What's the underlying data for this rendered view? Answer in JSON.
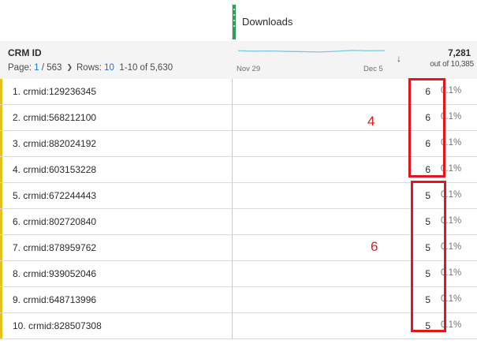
{
  "header": {
    "metric_title": "Downloads",
    "dimension_title": "CRM ID",
    "page_label": "Page:",
    "page_current": "1",
    "page_total": "/ 563",
    "rows_label": "Rows:",
    "rows_value": "10",
    "range_text": "1-10 of 5,630",
    "date_start": "Nov 29",
    "date_end": "Dec 5",
    "total_value": "7,281",
    "total_sub": "out of 10,385"
  },
  "sparkline": [
    0.62,
    0.6,
    0.61,
    0.58,
    0.57,
    0.55,
    0.59,
    0.64,
    0.62,
    0.63
  ],
  "rows": [
    {
      "label": "1. crmid:129236345",
      "value": "6",
      "pct": "0.1%"
    },
    {
      "label": "2. crmid:568212100",
      "value": "6",
      "pct": "0.1%"
    },
    {
      "label": "3. crmid:882024192",
      "value": "6",
      "pct": "0.1%"
    },
    {
      "label": "4. crmid:603153228",
      "value": "6",
      "pct": "0.1%"
    },
    {
      "label": "5. crmid:672244443",
      "value": "5",
      "pct": "0.1%"
    },
    {
      "label": "6. crmid:802720840",
      "value": "5",
      "pct": "0.1%"
    },
    {
      "label": "7. crmid:878959762",
      "value": "5",
      "pct": "0.1%"
    },
    {
      "label": "8. crmid:939052046",
      "value": "5",
      "pct": "0.1%"
    },
    {
      "label": "9. crmid:648713996",
      "value": "5",
      "pct": "0.1%"
    },
    {
      "label": "10. crmid:828507308",
      "value": "5",
      "pct": "0.1%"
    }
  ],
  "annotations": {
    "group1_count": "4",
    "group2_count": "6"
  },
  "colors": {
    "accent_blue": "#1473e6",
    "metric_handle": "#2ca05a",
    "row_bar": "#e3c21c",
    "annotation_red": "#e3161b",
    "sparkline": "#7fc6e0"
  }
}
